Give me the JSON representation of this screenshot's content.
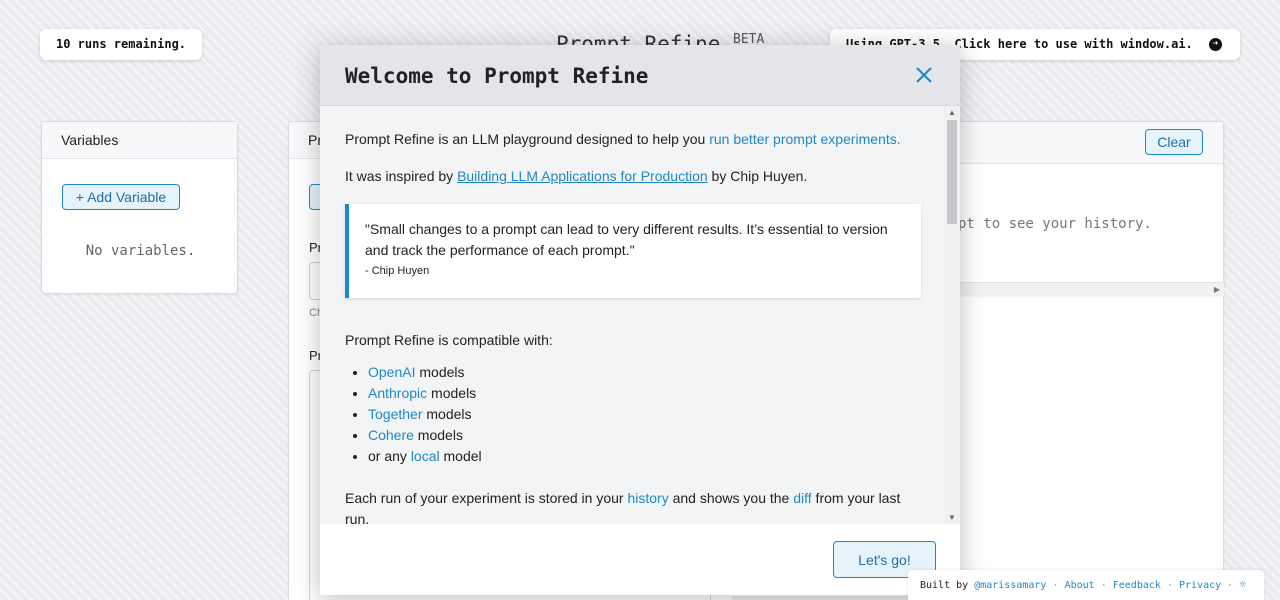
{
  "header": {
    "runs_remaining": "10 runs remaining.",
    "app_title": "Prompt Refine",
    "beta_badge": "BETA",
    "model_notice": "Using GPT-3.5. Click here to use with window.ai."
  },
  "variables_panel": {
    "title": "Variables",
    "add_button": "+ Add Variable",
    "empty_text": "No variables."
  },
  "prompt_panel": {
    "title_fragment": "Pr",
    "label1_fragment": "Pr",
    "hint_fragment": "Ch",
    "label2_fragment": "Pr"
  },
  "history_panel": {
    "clear_button": "Clear",
    "empty_text_fragment": "pt to see your history."
  },
  "modal": {
    "title": "Welcome to Prompt Refine",
    "intro_prefix": "Prompt Refine is an LLM playground designed to help you ",
    "intro_link": "run better prompt experiments.",
    "inspired_prefix": "It was inspired by ",
    "inspired_link": "Building LLM Applications for Production",
    "inspired_suffix": " by Chip Huyen.",
    "quote_text": "\"Small changes to a prompt can lead to very different results. It’s essential to version and track the performance of each prompt.\"",
    "quote_author": "- Chip Huyen",
    "compat_heading": "Prompt Refine is compatible with:",
    "compat_items": [
      {
        "link": "OpenAI",
        "suffix": " models"
      },
      {
        "link": "Anthropic",
        "suffix": " models"
      },
      {
        "link": "Together",
        "suffix": " models"
      },
      {
        "link": "Cohere",
        "suffix": " models"
      },
      {
        "prefix": "or any ",
        "link": "local",
        "suffix": " model"
      }
    ],
    "history_prefix": "Each run of your experiment is stored in your ",
    "history_link": "history",
    "history_mid": " and shows you the ",
    "diff_link": "diff",
    "history_suffix": " from your last run.",
    "cta_button": "Let's go!"
  },
  "footer": {
    "built_by": "Built by",
    "author": "@marissamary",
    "sep": "·",
    "about": "About",
    "feedback": "Feedback",
    "privacy": "Privacy"
  },
  "colors": {
    "accent": "#1e88c7",
    "accent_bg": "#e6f3fb",
    "modal_header": "#e4e5e9"
  }
}
